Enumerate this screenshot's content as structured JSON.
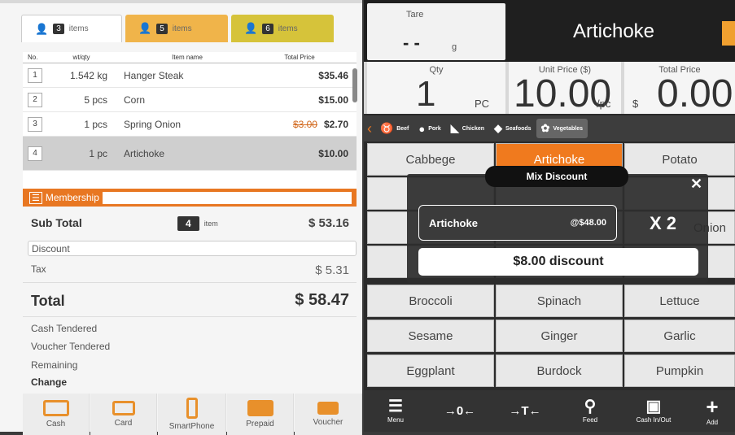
{
  "tabs": [
    {
      "count": "3",
      "label": "items"
    },
    {
      "count": "5",
      "label": "items"
    },
    {
      "count": "6",
      "label": "items"
    }
  ],
  "table": {
    "headers": [
      "No.",
      "wt/qty",
      "Item name",
      "Total Price"
    ],
    "rows": [
      {
        "no": "1",
        "qty": "1.542 kg",
        "name": "Hanger Steak",
        "old": "",
        "price": "$35.46"
      },
      {
        "no": "2",
        "qty": "5 pcs",
        "name": "Corn",
        "old": "",
        "price": "$15.00"
      },
      {
        "no": "3",
        "qty": "1 pcs",
        "name": "Spring Onion",
        "old": "$3.00",
        "price": "$2.70"
      },
      {
        "no": "4",
        "qty": "1 pc",
        "name": "Artichoke",
        "old": "",
        "price": "$10.00"
      }
    ]
  },
  "membership": {
    "label": "Membership",
    "icon": "id-card-icon"
  },
  "summary": {
    "subtotal_label": "Sub Total",
    "item_count": "4",
    "item_unit": "item",
    "subtotal": "$ 53.16",
    "discount_label": "Discount",
    "tax_label": "Tax",
    "tax": "$ 5.31",
    "total_label": "Total",
    "total": "$ 58.47",
    "cash_tendered": "Cash Tendered",
    "voucher_tendered": "Voucher Tendered",
    "remaining": "Remaining",
    "change": "Change"
  },
  "payments": [
    {
      "label": "Cash",
      "icon": "cash-icon"
    },
    {
      "label": "Card",
      "icon": "card-icon"
    },
    {
      "label": "SmartPhone",
      "icon": "smartphone-icon"
    },
    {
      "label": "Prepaid",
      "icon": "prepaid-icon"
    },
    {
      "label": "Voucher",
      "icon": "voucher-icon"
    }
  ],
  "scale": {
    "tare_label": "Tare",
    "tare_value": "- -",
    "tare_unit": "g",
    "product": "Artichoke"
  },
  "readouts": {
    "qty_label": "Qty",
    "qty": "1",
    "qty_unit": "PC",
    "unit_label": "Unit Price ($)",
    "unit_price": "10.00",
    "unit_unit": "/pc",
    "total_label": "Total Price",
    "total_currency": "$",
    "total_price": "0.00"
  },
  "categories": [
    {
      "label": "Beef",
      "icon": "beef-icon"
    },
    {
      "label": "Pork",
      "icon": "pork-icon"
    },
    {
      "label": "Chicken",
      "icon": "chicken-icon"
    },
    {
      "label": "Seafoods",
      "icon": "fish-icon"
    },
    {
      "label": "Vegetables",
      "icon": "vegetables-icon",
      "active": true
    }
  ],
  "products": [
    "Cabbege",
    "Artichoke",
    "Potato",
    "Broccoli",
    "Spinach",
    "Lettuce",
    "Sesame",
    "Ginger",
    "Garlic",
    "Eggplant",
    "Burdock",
    "Pumpkin"
  ],
  "products_visible_partial": [
    "Onion"
  ],
  "bottom": [
    {
      "label": "Menu",
      "glyph": "☰",
      "icon": "menu-icon"
    },
    {
      "label": "",
      "glyph": "→0←",
      "icon": "zero-icon"
    },
    {
      "label": "",
      "glyph": "→T←",
      "icon": "tare-icon"
    },
    {
      "label": "Feed",
      "glyph": "⚲",
      "icon": "feed-icon"
    },
    {
      "label": "Cash In/Out",
      "glyph": "▣",
      "icon": "cash-in-out-icon"
    },
    {
      "label": "Add",
      "glyph": "+",
      "icon": "add-icon"
    }
  ],
  "modal": {
    "title": "Mix Discount",
    "item": "Artichoke",
    "price": "@$48.00",
    "qty": "X 2",
    "discount": "$8.00 discount"
  }
}
